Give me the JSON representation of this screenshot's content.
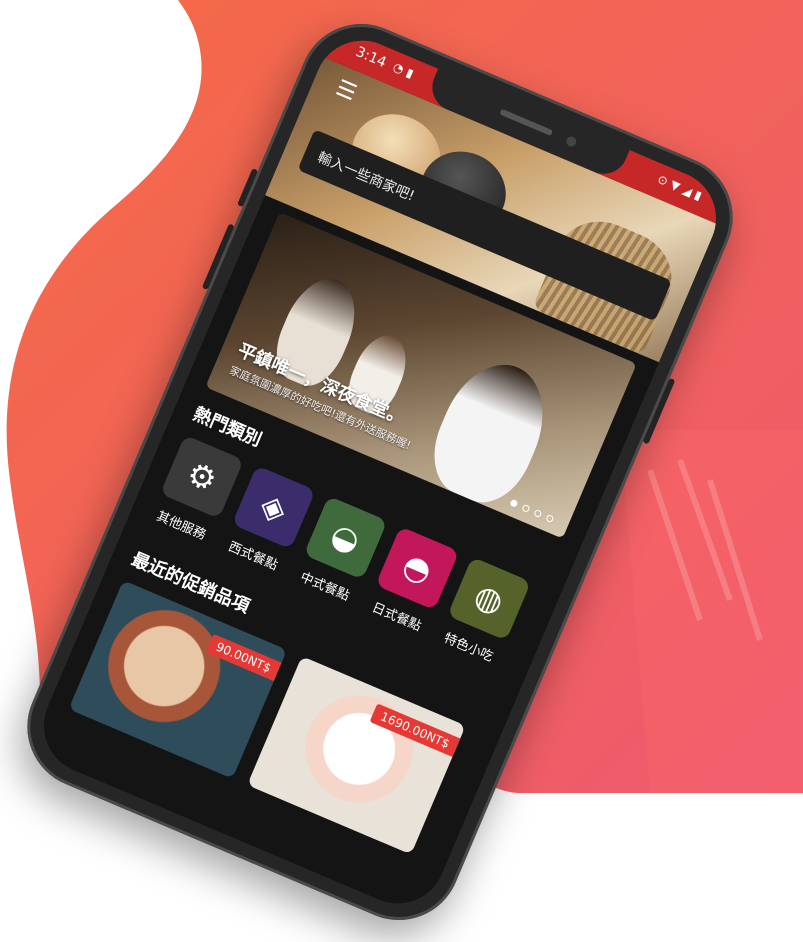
{
  "theme": {
    "accent": "#c62828",
    "background_gradient_start": "#f46b45",
    "background_gradient_end": "#ee5a6f",
    "screen_background": "#141414"
  },
  "status_bar": {
    "time": "3:14",
    "left_icons": [
      "notification-icon",
      "sim-icon"
    ],
    "right_icons": [
      "location-icon",
      "wifi-icon",
      "signal-icon",
      "battery-icon"
    ]
  },
  "header": {
    "menu_icon": "hamburger-menu-icon"
  },
  "search": {
    "placeholder": "輸入一些商家吧!"
  },
  "banner": {
    "title": "平鎮唯一，深夜食堂。",
    "subtitle": "家庭氛圍濃厚的好吃吧!還有外送服務喔!",
    "dots": 4,
    "active_dot": 0
  },
  "hot_categories": {
    "title": "熱門類別",
    "items": [
      {
        "label": "其他服務",
        "icon": "service-icon",
        "color": "#3a3a3a"
      },
      {
        "label": "西式餐點",
        "icon": "cake-icon",
        "color": "#3b2d6b"
      },
      {
        "label": "中式餐點",
        "icon": "rice-bowl-icon",
        "color": "#3f6b3c"
      },
      {
        "label": "日式餐點",
        "icon": "ramen-icon",
        "color": "#c2185b"
      },
      {
        "label": "特色小吃",
        "icon": "sushi-icon",
        "color": "#55622a"
      }
    ]
  },
  "promotions": {
    "title": "最近的促銷品項",
    "items": [
      {
        "price": "90.00NT$"
      },
      {
        "price": "1690.00NT$"
      }
    ]
  }
}
